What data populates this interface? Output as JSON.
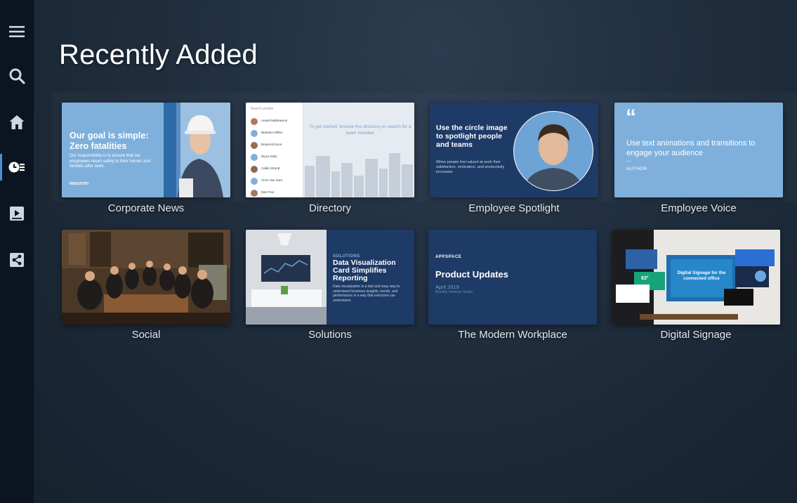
{
  "sidebar": {
    "items": [
      {
        "name": "menu-icon"
      },
      {
        "name": "search-icon"
      },
      {
        "name": "home-icon"
      },
      {
        "name": "recent-icon",
        "active": true
      },
      {
        "name": "playlist-icon"
      },
      {
        "name": "share-icon"
      }
    ]
  },
  "header": {
    "title": "Recently Added"
  },
  "cards": [
    {
      "label": "Corporate News",
      "thumb": {
        "headline_line1": "Our goal is simple:",
        "headline_line2": "Zero fatalities",
        "body": "Our responsibility is to ensure that our employees return safely to their homes and families after work.",
        "logo": "INDUSTRY",
        "bg": "#7fb0dc"
      }
    },
    {
      "label": "Directory",
      "thumb": {
        "search_placeholder": "Search people",
        "prompt": "To get started, browse the directory or search for a team member",
        "people": [
          "Anand Mathewson",
          "Brandon Hilliss",
          "Briana Ericson",
          "Bryce Kelly",
          "Caleb Strand",
          "Chris Van Horn",
          "Dan Tran"
        ]
      }
    },
    {
      "label": "Employee Spotlight",
      "thumb": {
        "headline": "Use the circle image to spotlight people and teams",
        "body": "When people feel valued at work their satisfaction, motivation, and productivity increases",
        "bg": "#1e3a66"
      }
    },
    {
      "label": "Employee Voice",
      "thumb": {
        "quote_mark": "“",
        "headline": "Use text animations and transitions to engage your audience",
        "dash": "—",
        "author": "AUTHOR",
        "bg": "#7fb0dc"
      }
    },
    {
      "label": "Social",
      "thumb": {}
    },
    {
      "label": "Solutions",
      "thumb": {
        "eyebrow": "SOLUTIONS",
        "headline": "Data Visualization Card Simplifies Reporting",
        "body": "Data visualization is a fast and easy way to understand business insights, trends, and performance in a way that everyone can understand.",
        "bg": "#1e3a66"
      }
    },
    {
      "label": "The Modern Workplace",
      "thumb": {
        "logo": "APPSPACE",
        "headline": "Product Updates",
        "date": "April 2019",
        "sub": "Monthly Webinar Series",
        "bg": "#1e3a66"
      }
    },
    {
      "label": "Digital Signage",
      "thumb": {
        "headline": "Digital Signage for the connected office",
        "temp": "63°"
      }
    }
  ]
}
